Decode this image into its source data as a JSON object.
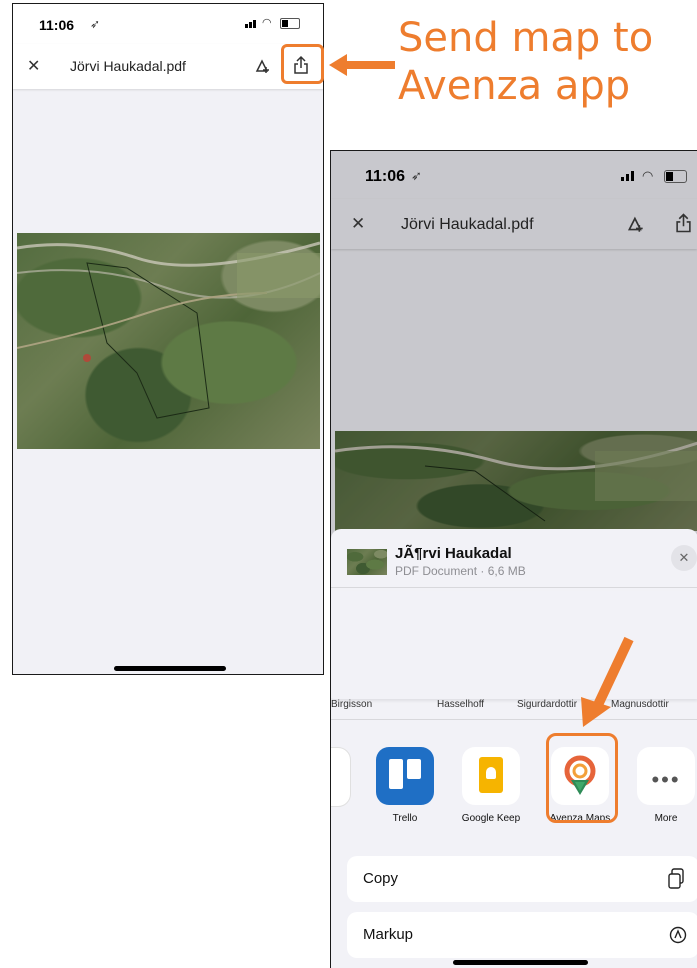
{
  "annotation": {
    "line1": "Send map to",
    "line2": "Avenza app",
    "color": "#ee7d2e"
  },
  "left_phone": {
    "status_time": "11:06",
    "file_title": "Jörvi Haukadal.pdf"
  },
  "right_phone": {
    "status_time": "11:06",
    "file_title": "Jörvi Haukadal.pdf",
    "share_sheet": {
      "doc_name": "JÃ¶rvi Haukadal",
      "doc_meta": "PDF Document · 6,6 MB",
      "contacts": [
        "Birgisson",
        "Hasselhoff",
        "Sigurdardottir",
        "Magnusdottir"
      ],
      "apps": [
        "Trello",
        "Google Keep",
        "Avenza Maps",
        "More"
      ],
      "actions": [
        "Copy",
        "Markup"
      ]
    }
  }
}
